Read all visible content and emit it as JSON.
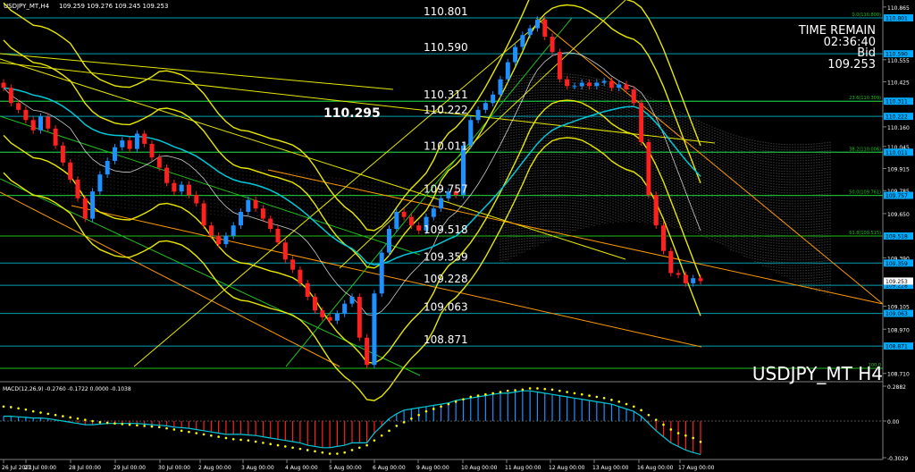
{
  "header": {
    "title": "USDJPY_MT,H4",
    "ohlc": "109.259 109.276 109.245 109.253"
  },
  "time_remain": {
    "label": "TIME REMAIN",
    "value": "02:36:40"
  },
  "bid": {
    "label": "Bid",
    "value": "109.253"
  },
  "watermark": "USDJPY_MT H4",
  "macd_label": "MACD(12,26,9) -0.2760 -0.1722 0.0000 -0.1038",
  "colors": {
    "bull": "#1e90ff",
    "bear": "#ff2020",
    "band": "#e8e800",
    "ema": "#00c8d8",
    "level": "#20c020",
    "trend": "#ff9900",
    "hline": "#00a0b0",
    "signal": "#ffff00"
  },
  "chart_data": [
    {
      "type": "candlestick",
      "title": "USDJPY_MT,H4",
      "ylim": [
        108.6,
        110.86
      ],
      "price_scale_ticks": [
        "110.865",
        "110.555",
        "110.425",
        "110.160",
        "110.045",
        "109.915",
        "109.785",
        "109.650",
        "109.390",
        "109.105",
        "108.970",
        "108.710"
      ],
      "level_labels": [
        {
          "text": "110.801",
          "y": 110.801
        },
        {
          "text": "110.590",
          "y": 110.59
        },
        {
          "text": "110.311",
          "y": 110.311
        },
        {
          "text": "110.222",
          "y": 110.222
        },
        {
          "text": "110.011",
          "y": 110.011
        },
        {
          "text": "109.757",
          "y": 109.757
        },
        {
          "text": "109.518",
          "y": 109.518
        },
        {
          "text": "109.359",
          "y": 109.359
        },
        {
          "text": "109.228",
          "y": 109.228
        },
        {
          "text": "109.063",
          "y": 109.063
        },
        {
          "text": "108.871",
          "y": 108.871
        }
      ],
      "marked_price": {
        "text": "110.295",
        "y": 110.295
      },
      "right_tags": [
        "110.801",
        "110.590",
        "110.311",
        "110.222",
        "110.011",
        "109.757",
        "109.518",
        "109.359",
        "109.228",
        "109.063",
        "108.871",
        "109.253"
      ],
      "fib_labels": [
        "0.0(110.800)",
        "23.6(110.309)",
        "38.2(110.006)",
        "50.0(109.761)",
        "61.8(109.515)",
        "100.0"
      ],
      "x_ticks": [
        "26 Jul 2021",
        "27 Jul 00:00",
        "28 Jul 00:00",
        "29 Jul 00:00",
        "30 Jul 00:00",
        "2 Aug 00:00",
        "3 Aug 00:00",
        "4 Aug 00:00",
        "5 Aug 00:00",
        "6 Aug 00:00",
        "9 Aug 00:00",
        "10 Aug 00:00",
        "11 Aug 00:00",
        "12 Aug 00:00",
        "13 Aug 00:00",
        "16 Aug 00:00",
        "17 Aug 00:00"
      ],
      "close": [
        110.39,
        110.3,
        110.26,
        110.2,
        110.14,
        110.22,
        110.15,
        110.05,
        109.95,
        109.85,
        109.74,
        109.62,
        109.78,
        109.88,
        109.96,
        110.04,
        110.08,
        110.03,
        110.12,
        110.06,
        109.98,
        109.92,
        109.83,
        109.78,
        109.82,
        109.76,
        109.71,
        109.58,
        109.52,
        109.47,
        109.52,
        109.58,
        109.66,
        109.73,
        109.68,
        109.62,
        109.56,
        109.48,
        109.38,
        109.32,
        109.24,
        109.16,
        109.08,
        109.04,
        109.02,
        109.06,
        109.12,
        109.16,
        108.92,
        108.76,
        109.18,
        109.42,
        109.56,
        109.66,
        109.63,
        109.58,
        109.55,
        109.63,
        109.68,
        109.74,
        109.78,
        109.76,
        110.05,
        110.2,
        110.26,
        110.3,
        110.35,
        110.44,
        110.54,
        110.63,
        110.7,
        110.74,
        110.79,
        110.69,
        110.6,
        110.44,
        110.4,
        110.4,
        110.42,
        110.4,
        110.42,
        110.43,
        110.39,
        110.41,
        110.38,
        110.3,
        110.07,
        109.76,
        109.58,
        109.43,
        109.3,
        109.29,
        109.24,
        109.27,
        109.253
      ],
      "series": [
        {
          "name": "MACD histogram",
          "values": [
            0.04,
            0.04,
            0.035,
            0.03,
            0.025,
            0.025,
            0.02,
            0.01,
            0,
            -0.01,
            -0.02,
            -0.03,
            -0.03,
            -0.025,
            -0.02,
            -0.02,
            -0.02,
            -0.02,
            -0.02,
            -0.025,
            -0.03,
            -0.035,
            -0.04,
            -0.05,
            -0.055,
            -0.06,
            -0.07,
            -0.08,
            -0.09,
            -0.1,
            -0.11,
            -0.11,
            -0.11,
            -0.115,
            -0.12,
            -0.13,
            -0.14,
            -0.15,
            -0.16,
            -0.17,
            -0.18,
            -0.2,
            -0.21,
            -0.22,
            -0.22,
            -0.21,
            -0.2,
            -0.18,
            -0.18,
            -0.18,
            -0.1,
            -0.04,
            0.02,
            0.06,
            0.09,
            0.1,
            0.11,
            0.12,
            0.13,
            0.14,
            0.15,
            0.17,
            0.18,
            0.19,
            0.2,
            0.21,
            0.22,
            0.23,
            0.23,
            0.24,
            0.25,
            0.25,
            0.24,
            0.23,
            0.22,
            0.21,
            0.2,
            0.19,
            0.18,
            0.17,
            0.16,
            0.15,
            0.14,
            0.12,
            0.1,
            0.08,
            0.04,
            -0.02,
            -0.08,
            -0.13,
            -0.18,
            -0.21,
            -0.24,
            -0.26,
            -0.276
          ]
        },
        {
          "name": "MACD signal",
          "values": [
            0.12,
            0.115,
            0.105,
            0.095,
            0.08,
            0.07,
            0.06,
            0.05,
            0.04,
            0.03,
            0.02,
            0.01,
            0,
            -0.01,
            -0.015,
            -0.02,
            -0.025,
            -0.03,
            -0.035,
            -0.04,
            -0.045,
            -0.05,
            -0.06,
            -0.07,
            -0.08,
            -0.09,
            -0.1,
            -0.11,
            -0.12,
            -0.13,
            -0.14,
            -0.15,
            -0.155,
            -0.16,
            -0.17,
            -0.18,
            -0.19,
            -0.2,
            -0.21,
            -0.22,
            -0.23,
            -0.24,
            -0.25,
            -0.26,
            -0.27,
            -0.27,
            -0.26,
            -0.24,
            -0.22,
            -0.2,
            -0.16,
            -0.12,
            -0.08,
            -0.04,
            -0.01,
            0.02,
            0.05,
            0.08,
            0.1,
            0.12,
            0.14,
            0.16,
            0.18,
            0.2,
            0.21,
            0.22,
            0.23,
            0.24,
            0.25,
            0.255,
            0.26,
            0.27,
            0.27,
            0.265,
            0.26,
            0.25,
            0.24,
            0.23,
            0.22,
            0.21,
            0.2,
            0.19,
            0.175,
            0.16,
            0.14,
            0.12,
            0.09,
            0.05,
            0.01,
            -0.03,
            -0.07,
            -0.1,
            -0.12,
            -0.14,
            -0.1722
          ]
        }
      ],
      "macd_ticks": [
        "0.2882",
        "0.00",
        "-0.3029"
      ]
    }
  ]
}
